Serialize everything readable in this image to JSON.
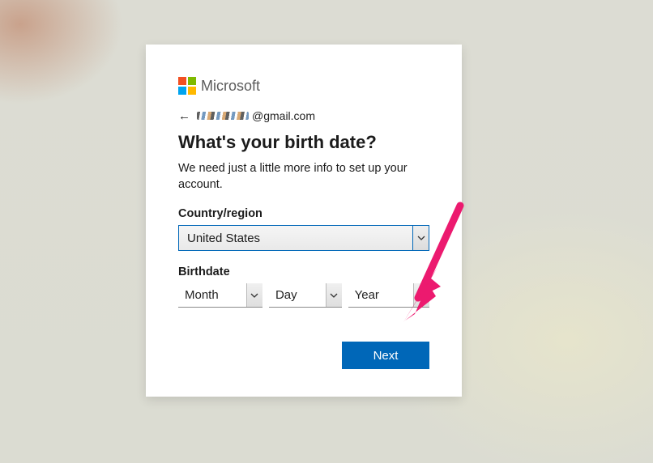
{
  "logo": {
    "brand": "Microsoft"
  },
  "identity": {
    "back_icon": "←",
    "email_suffix": "@gmail.com"
  },
  "heading": "What's your birth date?",
  "subtext": "We need just a little more info to set up your account.",
  "country": {
    "label": "Country/region",
    "selected": "United States"
  },
  "birthdate": {
    "label": "Birthdate",
    "month_placeholder": "Month",
    "day_placeholder": "Day",
    "year_placeholder": "Year"
  },
  "actions": {
    "next_label": "Next"
  },
  "icons": {
    "chevron_down": "⌄"
  }
}
